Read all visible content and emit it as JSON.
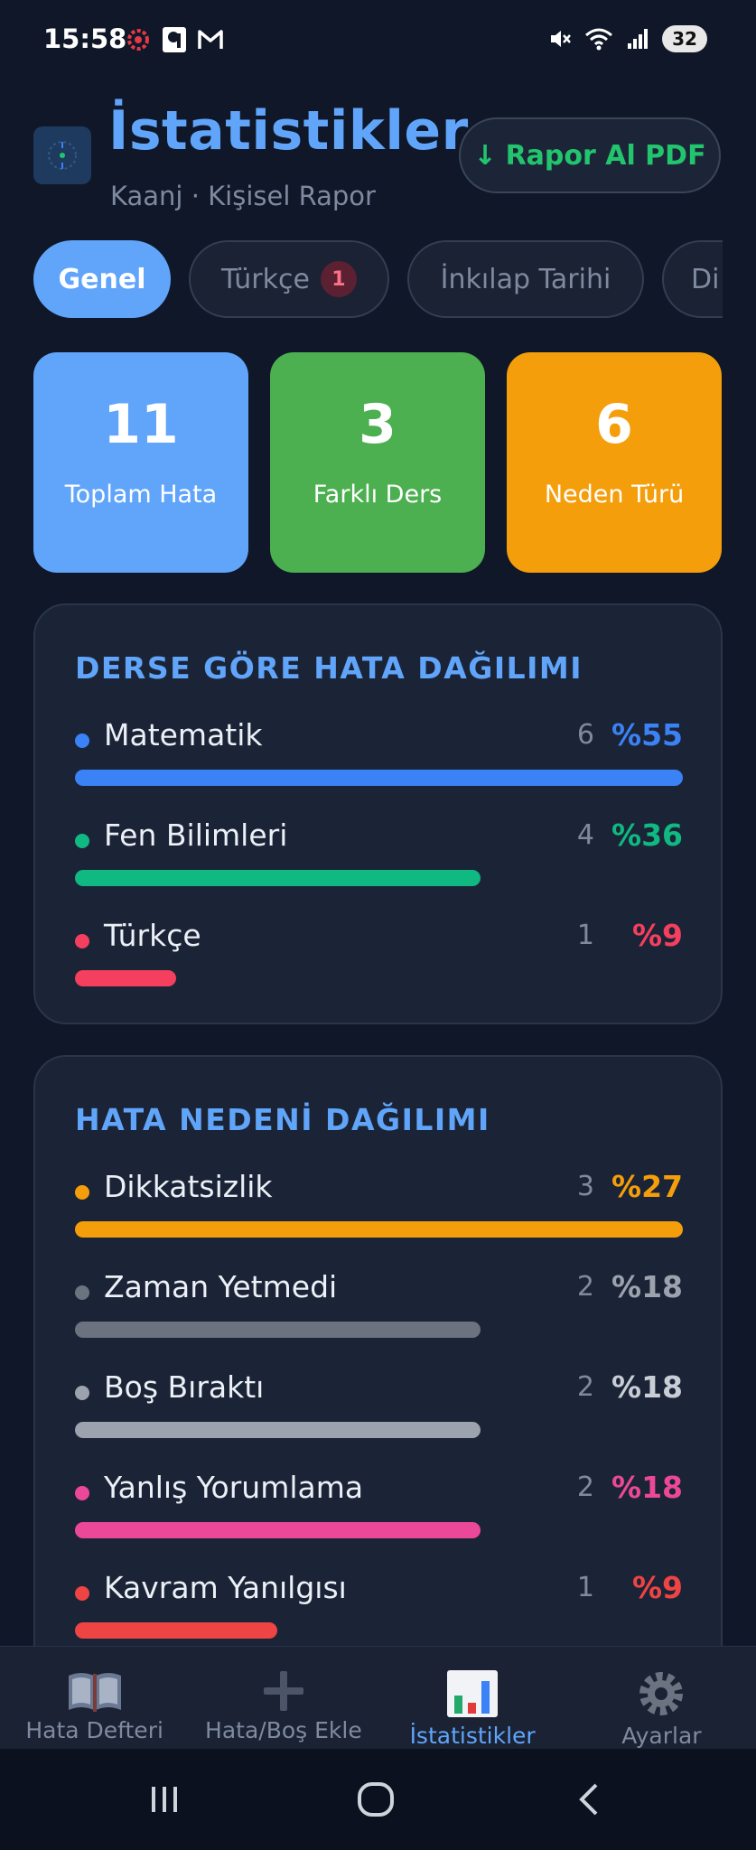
{
  "status_bar": {
    "time": "15:58",
    "battery": "32"
  },
  "header": {
    "title": "İstatistikler",
    "subtitle": "Kaanj · Kişisel Rapor",
    "pdf_button_label": "Rapor Al PDF",
    "pdf_arrow": "↓"
  },
  "tabs": [
    {
      "label": "Genel",
      "active": true
    },
    {
      "label": "Türkçe",
      "badge": "1"
    },
    {
      "label": "İnkılap Tarihi"
    },
    {
      "label": "Di"
    }
  ],
  "stats": [
    {
      "value": "11",
      "label": "Toplam Hata",
      "color": "#60a5fa"
    },
    {
      "value": "3",
      "label": "Farklı Ders",
      "color": "#4caf50"
    },
    {
      "value": "6",
      "label": "Neden Türü",
      "color": "#f59e0b"
    }
  ],
  "subject_panel": {
    "title": "DERSE GÖRE HATA DAĞILIMI",
    "rows": [
      {
        "label": "Matematik",
        "count": "6",
        "percent": "%55",
        "fraction": 1.0,
        "color": "#3b82f6"
      },
      {
        "label": "Fen Bilimleri",
        "count": "4",
        "percent": "%36",
        "fraction": 0.667,
        "color": "#10b981"
      },
      {
        "label": "Türkçe",
        "count": "1",
        "percent": "%9",
        "fraction": 0.167,
        "color": "#f43f5e"
      }
    ]
  },
  "reason_panel": {
    "title": "HATA NEDENİ DAĞILIMI",
    "rows": [
      {
        "label": "Dikkatsizlik",
        "count": "3",
        "percent": "%27",
        "fraction": 1.0,
        "color": "#f59e0b"
      },
      {
        "label": "Zaman Yetmedi",
        "count": "2",
        "percent": "%18",
        "fraction": 0.667,
        "color": "#6b7280"
      },
      {
        "label": "Boş Bıraktı",
        "count": "2",
        "percent": "%18",
        "fraction": 0.667,
        "color": "#9ca3af"
      },
      {
        "label": "Yanlış Yorumlama",
        "count": "2",
        "percent": "%18",
        "fraction": 0.667,
        "color": "#ec4899"
      },
      {
        "label": "Kavram Yanılgısı",
        "count": "1",
        "percent": "%9",
        "fraction": 0.333,
        "color": "#ef4444"
      }
    ]
  },
  "bottom_nav": [
    {
      "label": "Hata Defteri",
      "icon": "book-icon"
    },
    {
      "label": "Hata/Boş Ekle",
      "icon": "plus-icon"
    },
    {
      "label": "İstatistikler",
      "icon": "chart-icon",
      "active": true
    },
    {
      "label": "Ayarlar",
      "icon": "gear-icon"
    }
  ]
}
